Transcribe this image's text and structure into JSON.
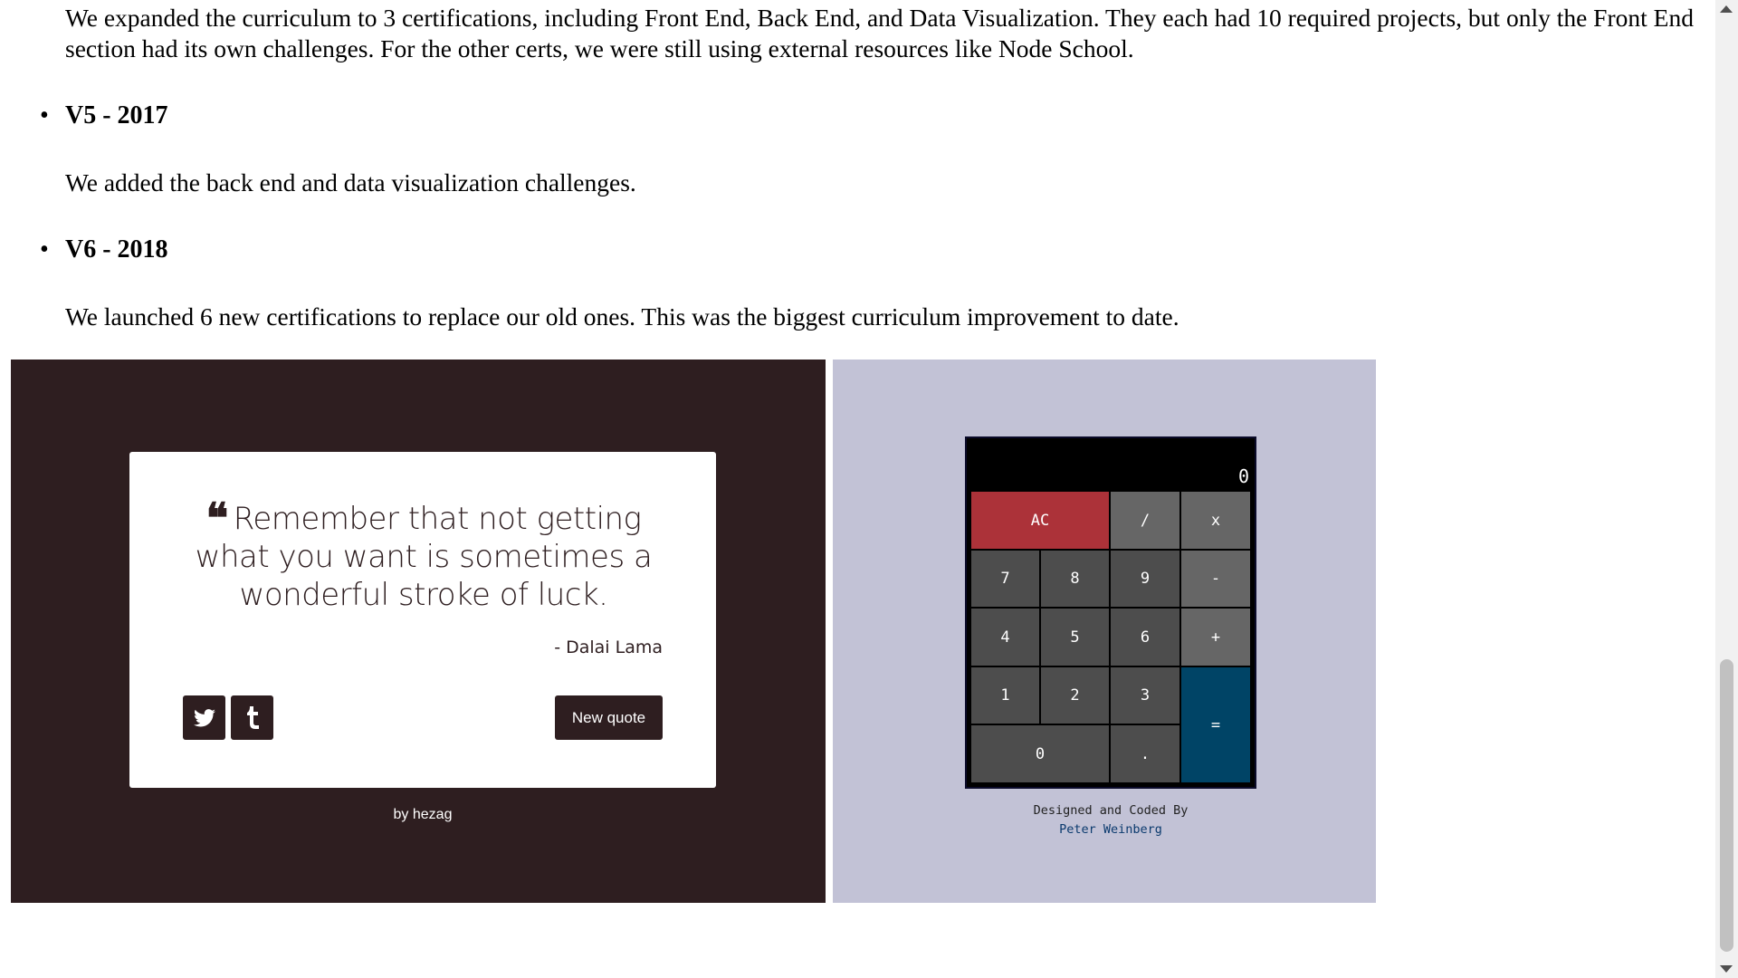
{
  "article": {
    "intro_paragraph": "We expanded the curriculum to 3 certifications, including Front End, Back End, and Data Visualization. They each had 10 required projects, but only the Front End section had its own challenges. For the other certs, we were still using external resources like Node School.",
    "items": [
      {
        "heading": "V5 - 2017",
        "text": "We added the back end and data visualization challenges."
      },
      {
        "heading": "V6 - 2018",
        "text": "We launched 6 new certifications to replace our old ones. This was the biggest curriculum improvement to date."
      }
    ]
  },
  "quote_machine": {
    "quote": "Remember that not getting what you want is sometimes a wonderful stroke of luck.",
    "author": "- Dalai Lama",
    "new_quote_label": "New quote",
    "byline_prefix": "by",
    "byline_author": "hezag",
    "icons": [
      "quote-left-icon",
      "twitter-icon",
      "tumblr-icon"
    ],
    "colors": {
      "background": "#2e1e20",
      "card": "#ffffff"
    }
  },
  "calculator": {
    "display_value": "0",
    "keys": {
      "clear": "AC",
      "divide": "/",
      "multiply": "x",
      "subtract": "-",
      "add": "+",
      "equals": "=",
      "seven": "7",
      "eight": "8",
      "nine": "9",
      "four": "4",
      "five": "5",
      "six": "6",
      "one": "1",
      "two": "2",
      "three": "3",
      "zero": "0",
      "decimal": "."
    },
    "credit_line": "Designed and Coded By",
    "credit_author": "Peter Weinberg",
    "colors": {
      "background": "#c2c2d6",
      "clear": "#ac3239",
      "equals": "#004466",
      "operator": "#666666",
      "digit": "#4d4d4d"
    }
  }
}
